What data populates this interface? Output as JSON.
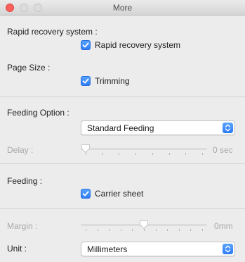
{
  "window": {
    "title": "More",
    "buttons": [
      "close-button",
      "minimize-button",
      "zoom-button"
    ]
  },
  "rapid_recovery": {
    "section_label": "Rapid recovery system :",
    "checkbox_label": "Rapid recovery system",
    "checked": true
  },
  "page_size": {
    "section_label": "Page Size :",
    "checkbox_label": "Trimming",
    "checked": true
  },
  "feeding_option": {
    "section_label": "Feeding Option :",
    "selected": "Standard Feeding"
  },
  "delay": {
    "label": "Delay :",
    "value_text": "0 sec",
    "value_fraction": 0.0,
    "enabled": false
  },
  "feeding": {
    "section_label": "Feeding :",
    "checkbox_label": "Carrier sheet",
    "checked": true
  },
  "margin": {
    "label": "Margin :",
    "value_text": "0mm",
    "value_fraction": 0.5,
    "enabled": false
  },
  "unit": {
    "label": "Unit :",
    "selected": "Millimeters"
  },
  "colors": {
    "accent": "#2f7cf6",
    "close": "#fc605c",
    "disabled_text": "#a9a9a9"
  }
}
